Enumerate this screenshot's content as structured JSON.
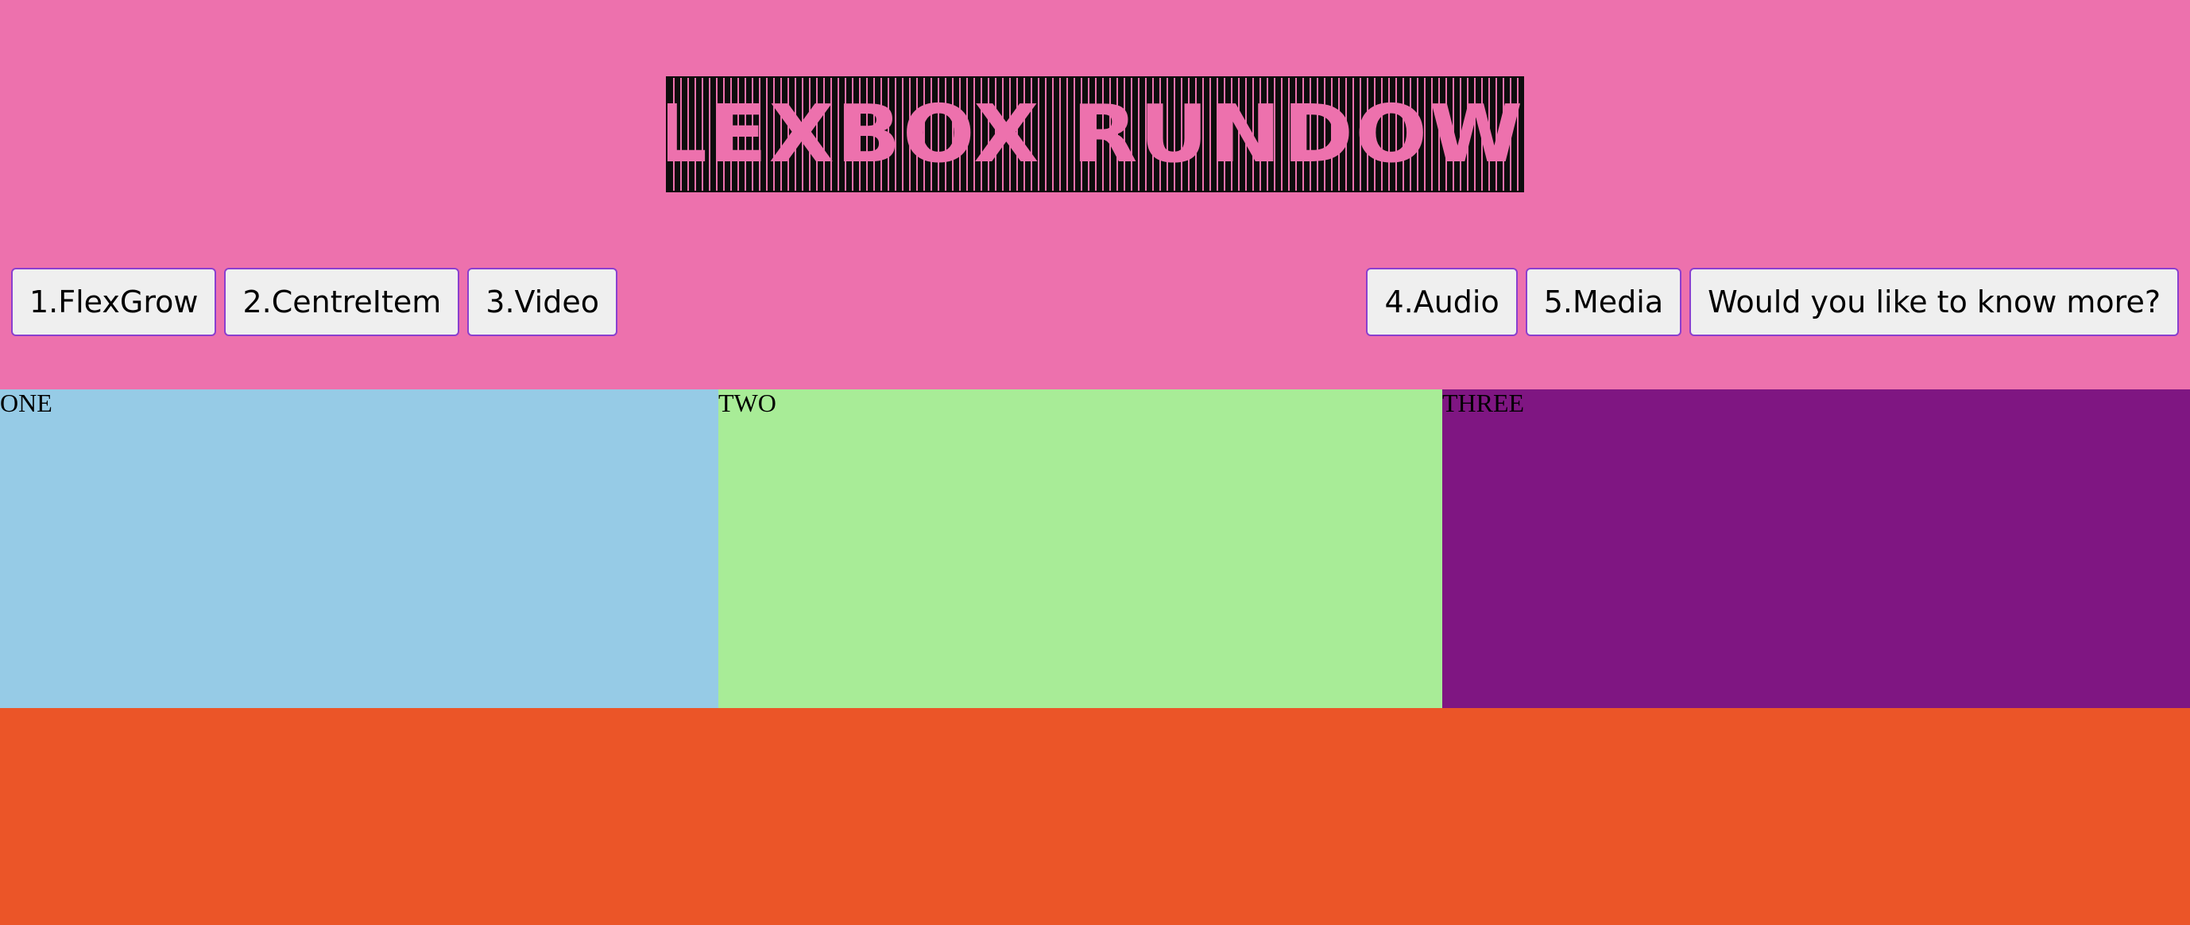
{
  "header": {
    "logo_text": "FLEXBOX RUNDOWN"
  },
  "nav": {
    "left": [
      "1.FlexGrow",
      "2.CentreItem",
      "3.Video"
    ],
    "right": [
      "4.Audio",
      "5.Media",
      "Would you like to know more?"
    ]
  },
  "panels": {
    "one": "ONE",
    "two": "TWO",
    "three": "THREE"
  },
  "colors": {
    "header_bg": "#ED71AD",
    "panel_one": "#96CBE6",
    "panel_two": "#A8EC97",
    "panel_three": "#7F1682",
    "footer_bg": "#EB5528",
    "button_border": "#8A3FCF"
  }
}
